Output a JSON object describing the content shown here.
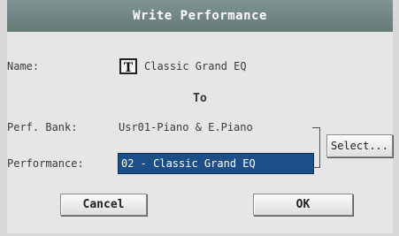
{
  "dialog": {
    "title": "Write Performance",
    "name_label": "Name:",
    "text_edit_icon_glyph": "T",
    "name_value": "Classic Grand EQ",
    "to_label": "To",
    "bank_label": "Perf. Bank:",
    "bank_value": "Usr01-Piano & E.Piano",
    "performance_label": "Performance:",
    "performance_value": "02 - Classic Grand EQ",
    "select_label": "Select...",
    "cancel_label": "Cancel",
    "ok_label": "OK"
  },
  "colors": {
    "title_bar": "#6f8583",
    "dialog_background": "#e6e6e6",
    "selected_field": "#1c4e88",
    "button_face": "#eeeeee"
  },
  "icons": {
    "text_edit": "text-edit-icon"
  }
}
